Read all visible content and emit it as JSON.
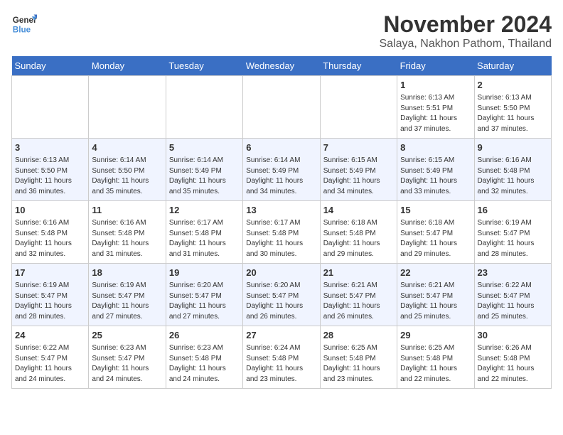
{
  "logo": {
    "line1": "General",
    "line2": "Blue"
  },
  "title": "November 2024",
  "location": "Salaya, Nakhon Pathom, Thailand",
  "days_of_week": [
    "Sunday",
    "Monday",
    "Tuesday",
    "Wednesday",
    "Thursday",
    "Friday",
    "Saturday"
  ],
  "weeks": [
    [
      {
        "day": "",
        "info": ""
      },
      {
        "day": "",
        "info": ""
      },
      {
        "day": "",
        "info": ""
      },
      {
        "day": "",
        "info": ""
      },
      {
        "day": "",
        "info": ""
      },
      {
        "day": "1",
        "info": "Sunrise: 6:13 AM\nSunset: 5:51 PM\nDaylight: 11 hours\nand 37 minutes."
      },
      {
        "day": "2",
        "info": "Sunrise: 6:13 AM\nSunset: 5:50 PM\nDaylight: 11 hours\nand 37 minutes."
      }
    ],
    [
      {
        "day": "3",
        "info": "Sunrise: 6:13 AM\nSunset: 5:50 PM\nDaylight: 11 hours\nand 36 minutes."
      },
      {
        "day": "4",
        "info": "Sunrise: 6:14 AM\nSunset: 5:50 PM\nDaylight: 11 hours\nand 35 minutes."
      },
      {
        "day": "5",
        "info": "Sunrise: 6:14 AM\nSunset: 5:49 PM\nDaylight: 11 hours\nand 35 minutes."
      },
      {
        "day": "6",
        "info": "Sunrise: 6:14 AM\nSunset: 5:49 PM\nDaylight: 11 hours\nand 34 minutes."
      },
      {
        "day": "7",
        "info": "Sunrise: 6:15 AM\nSunset: 5:49 PM\nDaylight: 11 hours\nand 34 minutes."
      },
      {
        "day": "8",
        "info": "Sunrise: 6:15 AM\nSunset: 5:49 PM\nDaylight: 11 hours\nand 33 minutes."
      },
      {
        "day": "9",
        "info": "Sunrise: 6:16 AM\nSunset: 5:48 PM\nDaylight: 11 hours\nand 32 minutes."
      }
    ],
    [
      {
        "day": "10",
        "info": "Sunrise: 6:16 AM\nSunset: 5:48 PM\nDaylight: 11 hours\nand 32 minutes."
      },
      {
        "day": "11",
        "info": "Sunrise: 6:16 AM\nSunset: 5:48 PM\nDaylight: 11 hours\nand 31 minutes."
      },
      {
        "day": "12",
        "info": "Sunrise: 6:17 AM\nSunset: 5:48 PM\nDaylight: 11 hours\nand 31 minutes."
      },
      {
        "day": "13",
        "info": "Sunrise: 6:17 AM\nSunset: 5:48 PM\nDaylight: 11 hours\nand 30 minutes."
      },
      {
        "day": "14",
        "info": "Sunrise: 6:18 AM\nSunset: 5:48 PM\nDaylight: 11 hours\nand 29 minutes."
      },
      {
        "day": "15",
        "info": "Sunrise: 6:18 AM\nSunset: 5:47 PM\nDaylight: 11 hours\nand 29 minutes."
      },
      {
        "day": "16",
        "info": "Sunrise: 6:19 AM\nSunset: 5:47 PM\nDaylight: 11 hours\nand 28 minutes."
      }
    ],
    [
      {
        "day": "17",
        "info": "Sunrise: 6:19 AM\nSunset: 5:47 PM\nDaylight: 11 hours\nand 28 minutes."
      },
      {
        "day": "18",
        "info": "Sunrise: 6:19 AM\nSunset: 5:47 PM\nDaylight: 11 hours\nand 27 minutes."
      },
      {
        "day": "19",
        "info": "Sunrise: 6:20 AM\nSunset: 5:47 PM\nDaylight: 11 hours\nand 27 minutes."
      },
      {
        "day": "20",
        "info": "Sunrise: 6:20 AM\nSunset: 5:47 PM\nDaylight: 11 hours\nand 26 minutes."
      },
      {
        "day": "21",
        "info": "Sunrise: 6:21 AM\nSunset: 5:47 PM\nDaylight: 11 hours\nand 26 minutes."
      },
      {
        "day": "22",
        "info": "Sunrise: 6:21 AM\nSunset: 5:47 PM\nDaylight: 11 hours\nand 25 minutes."
      },
      {
        "day": "23",
        "info": "Sunrise: 6:22 AM\nSunset: 5:47 PM\nDaylight: 11 hours\nand 25 minutes."
      }
    ],
    [
      {
        "day": "24",
        "info": "Sunrise: 6:22 AM\nSunset: 5:47 PM\nDaylight: 11 hours\nand 24 minutes."
      },
      {
        "day": "25",
        "info": "Sunrise: 6:23 AM\nSunset: 5:47 PM\nDaylight: 11 hours\nand 24 minutes."
      },
      {
        "day": "26",
        "info": "Sunrise: 6:23 AM\nSunset: 5:48 PM\nDaylight: 11 hours\nand 24 minutes."
      },
      {
        "day": "27",
        "info": "Sunrise: 6:24 AM\nSunset: 5:48 PM\nDaylight: 11 hours\nand 23 minutes."
      },
      {
        "day": "28",
        "info": "Sunrise: 6:25 AM\nSunset: 5:48 PM\nDaylight: 11 hours\nand 23 minutes."
      },
      {
        "day": "29",
        "info": "Sunrise: 6:25 AM\nSunset: 5:48 PM\nDaylight: 11 hours\nand 22 minutes."
      },
      {
        "day": "30",
        "info": "Sunrise: 6:26 AM\nSunset: 5:48 PM\nDaylight: 11 hours\nand 22 minutes."
      }
    ]
  ]
}
